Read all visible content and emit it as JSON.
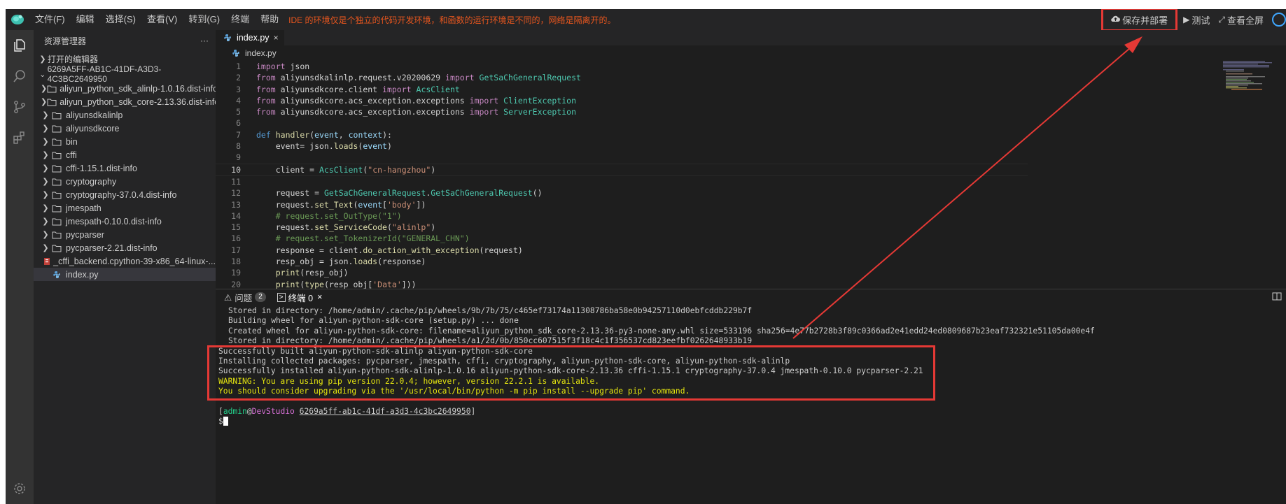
{
  "menubar": {
    "menus": [
      "文件(F)",
      "编辑",
      "选择(S)",
      "查看(V)",
      "转到(G)",
      "终端",
      "帮助"
    ],
    "notice": "IDE 的环境仅是个独立的代码开发环境，和函数的运行环境是不同的，网络是隔离开的。",
    "actions": {
      "deploy": "保存并部署",
      "test": "测试",
      "fullscreen": "查看全屏"
    }
  },
  "sidebar": {
    "title": "资源管理器",
    "more": "···",
    "open_editors": "打开的编辑器",
    "root": "6269A5FF-AB1C-41DF-A3D3-4C3BC2649950",
    "items": [
      {
        "label": "aliyun_python_sdk_alinlp-1.0.16.dist-info",
        "type": "folder"
      },
      {
        "label": "aliyun_python_sdk_core-2.13.36.dist-info",
        "type": "folder"
      },
      {
        "label": "aliyunsdkalinlp",
        "type": "folder"
      },
      {
        "label": "aliyunsdkcore",
        "type": "folder"
      },
      {
        "label": "bin",
        "type": "folder"
      },
      {
        "label": "cffi",
        "type": "folder"
      },
      {
        "label": "cffi-1.15.1.dist-info",
        "type": "folder"
      },
      {
        "label": "cryptography",
        "type": "folder"
      },
      {
        "label": "cryptography-37.0.4.dist-info",
        "type": "folder"
      },
      {
        "label": "jmespath",
        "type": "folder"
      },
      {
        "label": "jmespath-0.10.0.dist-info",
        "type": "folder"
      },
      {
        "label": "pycparser",
        "type": "folder"
      },
      {
        "label": "pycparser-2.21.dist-info",
        "type": "folder"
      },
      {
        "label": "_cffi_backend.cpython-39-x86_64-linux-...",
        "type": "binary"
      },
      {
        "label": "index.py",
        "type": "python"
      }
    ]
  },
  "editor": {
    "tab": "index.py",
    "tab_close": "×",
    "breadcrumb": "index.py",
    "current_line": 10,
    "lines": [
      {
        "n": "1",
        "code": "import json"
      },
      {
        "n": "2",
        "code": "from aliyunsdkalinlp.request.v20200629 import GetSaChGeneralRequest"
      },
      {
        "n": "3",
        "code": "from aliyunsdkcore.client import AcsClient"
      },
      {
        "n": "4",
        "code": "from aliyunsdkcore.acs_exception.exceptions import ClientException"
      },
      {
        "n": "5",
        "code": "from aliyunsdkcore.acs_exception.exceptions import ServerException"
      },
      {
        "n": "6",
        "code": ""
      },
      {
        "n": "7",
        "code": "def handler(event, context):"
      },
      {
        "n": "8",
        "code": "    event= json.loads(event)"
      },
      {
        "n": "9",
        "code": ""
      },
      {
        "n": "10",
        "code": "    client = AcsClient(\"cn-hangzhou\")"
      },
      {
        "n": "11",
        "code": ""
      },
      {
        "n": "12",
        "code": "    request = GetSaChGeneralRequest.GetSaChGeneralRequest()"
      },
      {
        "n": "13",
        "code": "    request.set_Text(event['body'])"
      },
      {
        "n": "14",
        "code": "    # request.set_OutType(\"1\")"
      },
      {
        "n": "15",
        "code": "    request.set_ServiceCode(\"alinlp\")"
      },
      {
        "n": "16",
        "code": "    # request.set_TokenizerId(\"GENERAL_CHN\")"
      },
      {
        "n": "17",
        "code": "    response = client.do_action_with_exception(request)"
      },
      {
        "n": "18",
        "code": "    resp_obj = json.loads(response)"
      },
      {
        "n": "19",
        "code": "    print(resp_obj)"
      },
      {
        "n": "20",
        "code": "    print(type(resp_obj['Data']))"
      }
    ]
  },
  "panel": {
    "tabs": [
      {
        "label": "问题",
        "badge": "2"
      },
      {
        "label": "终端 0",
        "badge": ""
      }
    ],
    "tab_close": "×",
    "terminal": [
      "Stored in directory: /home/admin/.cache/pip/wheels/9b/7b/75/c465ef73174a11308786ba58e0b94257110d0ebfcddb229b7f",
      "Building wheel for aliyun-python-sdk-core (setup.py) ... done",
      "Created wheel for aliyun-python-sdk-core: filename=aliyun_python_sdk_core-2.13.36-py3-none-any.whl size=533196 sha256=4e77b2728b3f89c0366ad2e41edd24ed0809687b23eaf732321e51105da00e4f",
      "Stored in directory: /home/admin/.cache/pip/wheels/a1/2d/0b/850cc607515f3f18c4c1f356537cd823eefbf0262648933b19",
      "Successfully built aliyun-python-sdk-alinlp aliyun-python-sdk-core",
      "Installing collected packages: pycparser, jmespath, cffi, cryptography, aliyun-python-sdk-core, aliyun-python-sdk-alinlp",
      "Successfully installed aliyun-python-sdk-alinlp-1.0.16 aliyun-python-sdk-core-2.13.36 cffi-1.15.1 cryptography-37.0.4 jmespath-0.10.0 pycparser-2.21",
      "WARNING: You are using pip version 22.0.4; however, version 22.2.1 is available.",
      "You should consider upgrading via the '/usr/local/bin/python -m pip install --upgrade pip' command."
    ],
    "prompt": {
      "open": "[",
      "user": "admin",
      "at": "@",
      "host": "DevStudio",
      "path": "6269a5ff-ab1c-41df-a3d3-4c3bc2649950",
      "close": "]",
      "dollar": "$"
    }
  },
  "colors": {
    "annotation": "#e53935",
    "accent": "#007acc"
  }
}
